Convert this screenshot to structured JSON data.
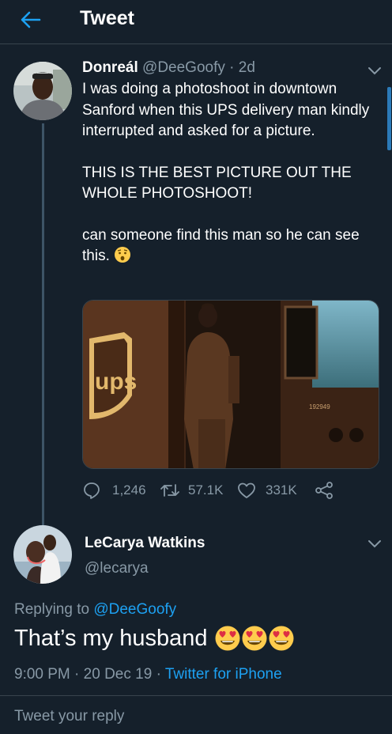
{
  "header": {
    "title": "Tweet",
    "back_icon": "arrow-left-icon"
  },
  "colors": {
    "background": "#15202b",
    "accent": "#1da1f2",
    "muted": "#8899a6",
    "divider": "#38444d"
  },
  "tweet": {
    "author_name": "Donreál",
    "author_handle": "@DeeGoofy",
    "separator": "·",
    "age": "2d",
    "paragraph_1": "I was doing a photoshoot in downtown Sanford when this UPS delivery man kindly interrupted and asked for a picture.",
    "paragraph_2": " THIS IS THE BEST PICTURE OUT THE WHOLE PHOTOSHOOT!",
    "paragraph_3": " can someone find this man so he can see this.",
    "media": {
      "logo_text": "ups",
      "truck_number": "192949"
    },
    "stats": {
      "replies": "1,246",
      "retweets": "57.1K",
      "likes": "331K"
    }
  },
  "reply": {
    "author_name": "LeCarya Watkins",
    "author_handle": "@lecarya",
    "replying_prefix": "Replying to",
    "replying_to": "@DeeGoofy",
    "text": "That’s my husband",
    "time": "9:00 PM",
    "date": "20 Dec 19",
    "separator": "·",
    "source": "Twitter for iPhone"
  },
  "composer": {
    "placeholder": "Tweet your reply"
  }
}
